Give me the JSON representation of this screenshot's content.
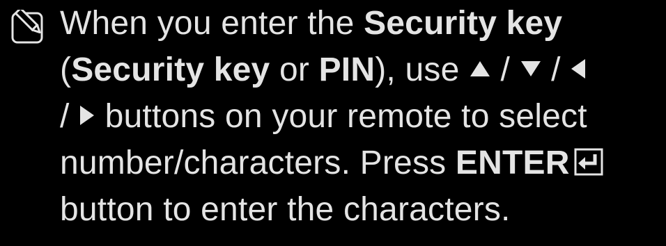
{
  "note": {
    "icon": "note-pencil-icon",
    "text_color": "#e4e4e4",
    "background": "#000000",
    "line1": {
      "prefix": "When you enter the ",
      "bold": "Security key"
    },
    "line2": {
      "open_paren": "(",
      "bold1": "Security key",
      "or": " or ",
      "bold2": "PIN",
      "suffix": "), use ",
      "sep1": " / ",
      "sep2": " / "
    },
    "line3": {
      "sep": "/ ",
      "suffix": " buttons on your remote to select"
    },
    "line4": {
      "prefix": "number/characters. Press ",
      "bold": "ENTER",
      "enter_icon": "enter-icon"
    },
    "line5": {
      "text": "button to enter the characters."
    },
    "arrows": [
      "up-arrow-icon",
      "down-arrow-icon",
      "left-arrow-icon",
      "right-arrow-icon"
    ]
  }
}
